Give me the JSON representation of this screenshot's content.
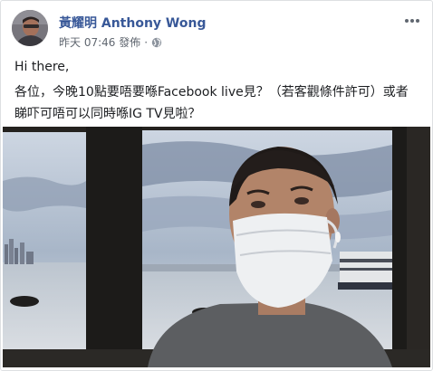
{
  "post": {
    "author": "黃耀明 Anthony Wong",
    "timestamp": "昨天 07:46 發佈",
    "separator": "·",
    "privacy_icon": "globe-icon",
    "more_icon": "more-options-icon",
    "text_line_1": "Hi there,",
    "text_line_2": "各位，今晚10點要唔要喺Facebook live見？（若客觀條件許可）或者睇吓可唔可以同時喺IG TV見啦？"
  },
  "colors": {
    "author": "#385898",
    "meta": "#606770",
    "body_text": "#1c1e21"
  }
}
